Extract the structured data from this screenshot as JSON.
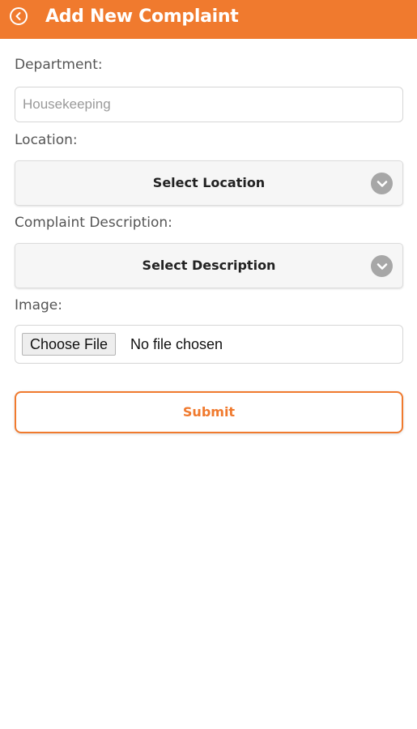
{
  "header": {
    "title": "Add New Complaint",
    "back_icon": "back-arrow-circle-icon",
    "background": "#f07a2e"
  },
  "form": {
    "department": {
      "label": "Department:",
      "value": "Housekeeping"
    },
    "location": {
      "label": "Location:",
      "selected": "Select Location",
      "icon": "chevron-down-icon"
    },
    "description": {
      "label": "Complaint Description:",
      "selected": "Select Description",
      "icon": "chevron-down-icon"
    },
    "image": {
      "label": "Image:",
      "choose_label": "Choose File",
      "status": "No file chosen"
    },
    "submit_label": "Submit"
  },
  "colors": {
    "accent": "#f07a2e",
    "label_text": "#555555",
    "chevron_bg": "#a7a7a7"
  }
}
